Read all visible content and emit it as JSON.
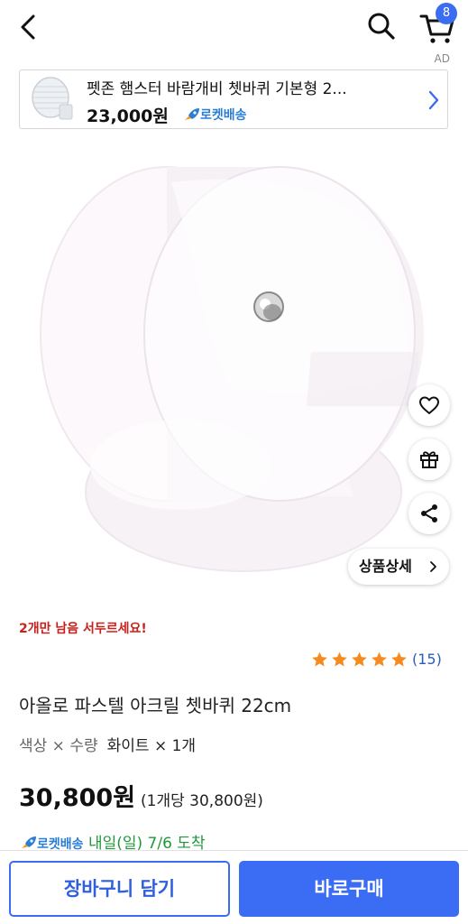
{
  "header": {
    "cart_count": "8",
    "ad_label": "AD"
  },
  "ad_card": {
    "title": "펫존 햄스터 바람개비 쳇바퀴 기본형 2...",
    "price": "23,000원",
    "rocket_label": "로켓배송"
  },
  "product": {
    "detail_button_label": "상품상세",
    "stock_warning": "2개만 남음 서두르세요!",
    "rating_stars": 5,
    "review_count": "(15)",
    "title": "아올로 파스텔 아크릴 쳇바퀴 22cm",
    "option_label": "색상 × 수량",
    "option_value": "화이트 × 1개",
    "price": "30,800원",
    "unit_price": "(1개당 30,800원)",
    "delivery_rocket": "로켓배송",
    "delivery_text": "내일(일) 7/6 도착"
  },
  "bottom_bar": {
    "cart_button": "장바구니 담기",
    "buy_button": "바로구매"
  },
  "colors": {
    "accent": "#3a6cf4",
    "warning": "#c8201a",
    "rocket": "#2a7fd4",
    "delivery": "#1e9a3a",
    "star": "#f58a1f"
  },
  "icons": [
    "back-arrow-icon",
    "search-icon",
    "cart-icon",
    "rocket-icon",
    "chevron-right-icon",
    "heart-icon",
    "gift-icon",
    "share-icon",
    "star-icon"
  ]
}
